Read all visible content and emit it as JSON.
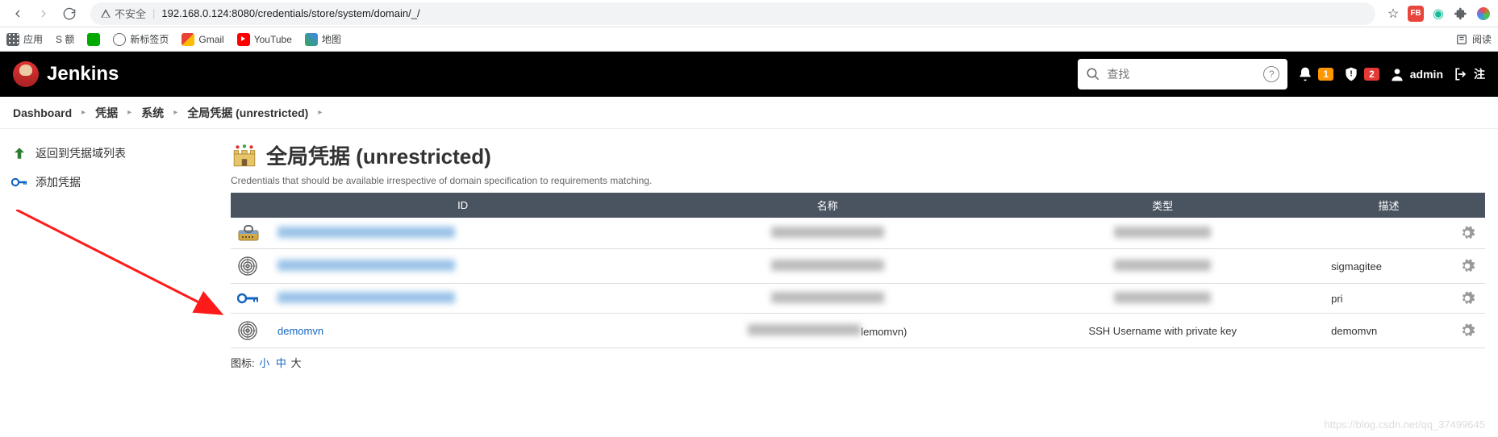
{
  "browser": {
    "insecure_label": "不安全",
    "url": "192.168.0.124:8080/credentials/store/system/domain/_/",
    "reading_list": "阅读"
  },
  "bookmarks": {
    "apps": "应用",
    "s_item": "S 额",
    "new_tab": "新标签页",
    "gmail": "Gmail",
    "youtube": "YouTube",
    "map": "地图"
  },
  "header": {
    "brand": "Jenkins",
    "search_placeholder": "查找",
    "bell_count": "1",
    "shield_count": "2",
    "user": "admin",
    "logout": "注"
  },
  "crumbs": [
    "Dashboard",
    "凭据",
    "系统",
    "全局凭据 (unrestricted)"
  ],
  "sidebar": {
    "back": "返回到凭据域列表",
    "add": "添加凭据"
  },
  "page": {
    "title": "全局凭据 (unrestricted)",
    "subtitle": "Credentials that should be available irrespective of domain specification to requirements matching."
  },
  "table": {
    "headers": {
      "id": "ID",
      "name": "名称",
      "type": "类型",
      "desc": "描述"
    },
    "rows": [
      {
        "icon": "password",
        "id": "",
        "name": "",
        "type": "",
        "desc": "",
        "blur": true
      },
      {
        "icon": "fingerprint",
        "id": "",
        "name": "",
        "type": "",
        "desc": "sigmagitee",
        "blur": true
      },
      {
        "icon": "key",
        "id": "",
        "name": "",
        "type": "",
        "desc": "pri",
        "blur": true
      },
      {
        "icon": "fingerprint",
        "id": "demomvn",
        "name": "lemomvn)",
        "type": "SSH Username with private key",
        "desc": "demomvn",
        "blur": false,
        "name_blur": true
      }
    ]
  },
  "icon_sizes": {
    "label": "图标:",
    "small": "小",
    "medium": "中",
    "large": "大"
  },
  "watermark": "https://blog.csdn.net/qq_37499645"
}
